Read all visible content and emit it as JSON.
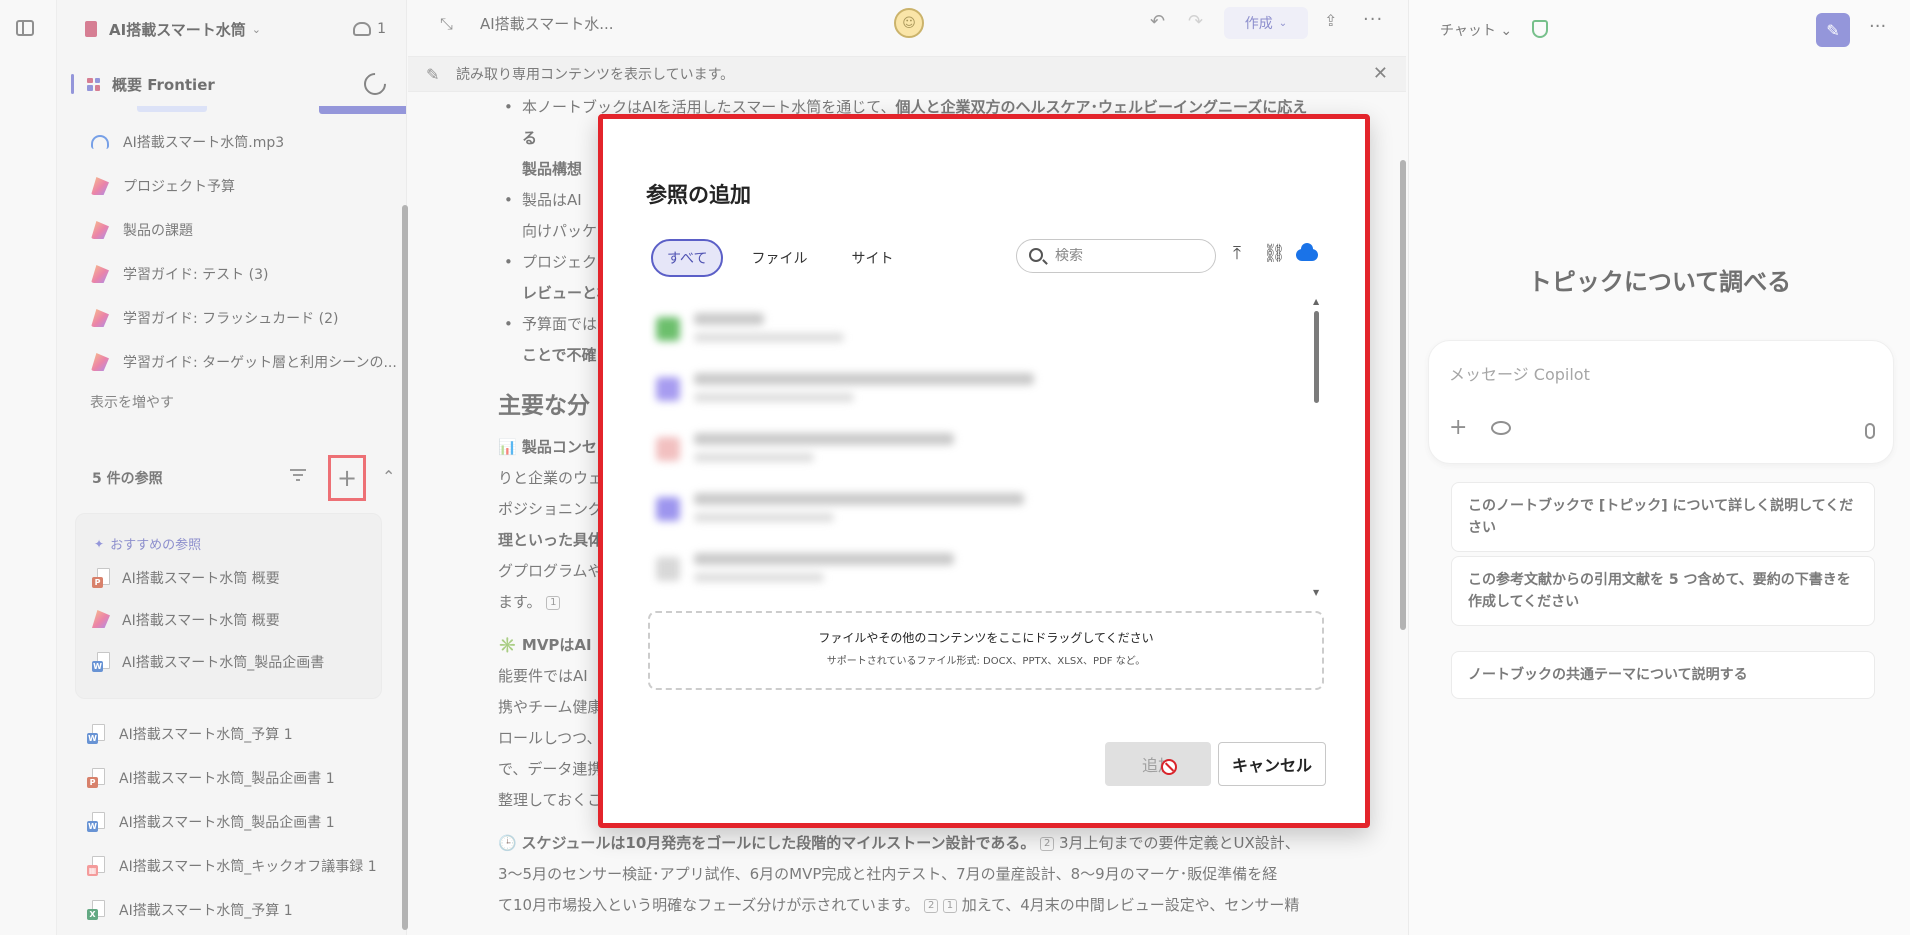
{
  "sidebar": {
    "notebook_title": "AI搭載スマート水筒",
    "member_count": "1",
    "overview_label": "概要 Frontier",
    "pages": [
      {
        "label": "AI搭載スマート水筒.mp3",
        "icon": "headphones-icon"
      },
      {
        "label": "プロジェクト予算",
        "icon": "loop-page-icon"
      },
      {
        "label": "製品の課題",
        "icon": "loop-page-icon"
      },
      {
        "label": "学習ガイド: テスト (3)",
        "icon": "loop-page-icon"
      },
      {
        "label": "学習ガイド: フラッシュカード (2)",
        "icon": "loop-page-icon"
      },
      {
        "label": "学習ガイド: ターゲット層と利用シーンの...",
        "icon": "loop-page-icon"
      }
    ],
    "show_more": "表示を増やす",
    "references_count_label": "5 件の参照",
    "recommended": {
      "title": "おすすめの参照",
      "items": [
        {
          "label": "AI搭載スマート水筒 概要",
          "type": "P"
        },
        {
          "label": "AI搭載スマート水筒 概要",
          "type": "loop"
        },
        {
          "label": "AI搭載スマート水筒_製品企画書",
          "type": "W"
        }
      ]
    },
    "references": [
      {
        "label": "AI搭載スマート水筒_予算 1",
        "type": "W"
      },
      {
        "label": "AI搭載スマート水筒_製品企画書 1",
        "type": "P"
      },
      {
        "label": "AI搭載スマート水筒_製品企画書 1",
        "type": "W"
      },
      {
        "label": "AI搭載スマート水筒_キックオフ議事録 1",
        "type": "C"
      },
      {
        "label": "AI搭載スマート水筒_予算 1",
        "type": "X"
      }
    ]
  },
  "main": {
    "title": "AI搭載スマート水...",
    "avatar_initial": "☺",
    "create_label": "作成",
    "notice": "読み取り専用コンテンツを表示しています。",
    "bullets": [
      {
        "pre": "本ノートブックはAIを活用したスマート水筒を通じて、",
        "bold": "個人と企業双方のヘルスケア･ウェルビーイングニーズに応える",
        "line2": "製品構想"
      },
      {
        "pre": "製品はAI",
        "line2": "向けパッケ"
      },
      {
        "pre": "プロジェクト",
        "line2": "レビューと杉"
      },
      {
        "pre": "予算面では",
        "line2": "ことで不確"
      }
    ],
    "section_heading": "主要な分",
    "para1_lines": [
      "📊 製品コンセ",
      "りと企業のウェ",
      "ポジショニングを",
      "理といった具体",
      "グプログラムやス",
      "ます。"
    ],
    "para2_lines": [
      "✳️ MVPはAI",
      "能要件ではAI",
      "携やチーム健康",
      "ロールしつつ、コ",
      "で、データ連携",
      "整理しておくこ"
    ],
    "para3_title": "スケジュールは10月発売をゴールにした段階的マイルストーン設計である。",
    "para3_lines": [
      "3月上旬までの要件定義とUX設計、",
      "3〜5月のセンサー検証･アプリ試作、6月のMVP完成と社内テスト、7月の量産設計、8〜9月のマーケ･販促準備を経",
      "て10月市場投入という明確なフェーズ分けが示されています。",
      "加えて、4月末の中間レビュー設定や、センサー精"
    ]
  },
  "right_panel": {
    "chat_label": "チャット",
    "heading": "トピックについて調べる",
    "input_placeholder": "メッセージ Copilot",
    "suggestions": [
      "このノートブックで [トピック] について詳しく説明してください",
      "この参考文献からの引用文献を 5 つ含めて、要約の下書きを作成してください",
      "ノートブックの共通テーマについて説明する"
    ]
  },
  "modal": {
    "title": "参照の追加",
    "tabs": [
      "すべて",
      "ファイル",
      "サイト"
    ],
    "active_tab": "すべて",
    "search_placeholder": "検索",
    "dropzone_title": "ファイルやその他のコンテンツをここにドラッグしてください",
    "dropzone_subtitle": "サポートされているファイル形式: DOCX、PPTX、XLSX、PDF など。",
    "add_label": "追加",
    "cancel_label": "キャンセル"
  },
  "colors": {
    "accent": "#5b5fc7",
    "highlight_border": "#e3242b"
  }
}
